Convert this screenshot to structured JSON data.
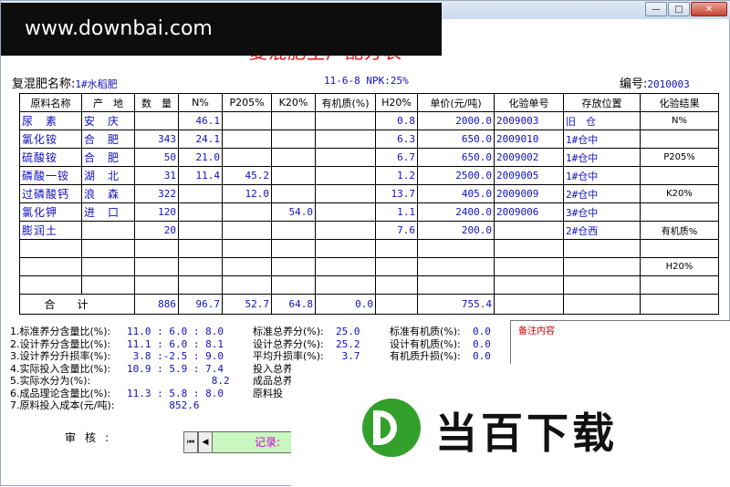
{
  "window": {
    "minimize_glyph": "—",
    "maximize_glyph": "□",
    "close_glyph": "✕"
  },
  "watermark": "www.downbai.com",
  "title": "复混肥生产配方表",
  "header": {
    "name_label": "复混肥名称:",
    "name_value": "1#水稻肥",
    "formula": "11-6-8 NPK:25%",
    "number_label": "编号:",
    "number_value": "2010003"
  },
  "table": {
    "columns": [
      "原料名称",
      "产　地",
      "数　量",
      "N%",
      "P205%",
      "K20%",
      "有机质(%)",
      "H20%",
      "单价(元/吨)",
      "化验单号",
      "存放位置",
      "化验结果"
    ],
    "rows": [
      {
        "name": "尿　素",
        "place": "安　庆",
        "qty": "",
        "n": "46.1",
        "p": "",
        "k": "",
        "org": "",
        "h2o": "0.8",
        "price": "2000.0",
        "test": "2009003",
        "loc": "旧　仓",
        "result": "N%"
      },
      {
        "name": "氯化铵",
        "place": "合　肥",
        "qty": "343",
        "n": "24.1",
        "p": "",
        "k": "",
        "org": "",
        "h2o": "6.3",
        "price": "650.0",
        "test": "2009010",
        "loc": "1#仓中",
        "result": ""
      },
      {
        "name": "硫酸铵",
        "place": "合　肥",
        "qty": "50",
        "n": "21.0",
        "p": "",
        "k": "",
        "org": "",
        "h2o": "6.7",
        "price": "650.0",
        "test": "2009002",
        "loc": "1#仓中",
        "result": "P205%"
      },
      {
        "name": "磷酸一铵",
        "place": "湖　北",
        "qty": "31",
        "n": "11.4",
        "p": "45.2",
        "k": "",
        "org": "",
        "h2o": "1.2",
        "price": "2500.0",
        "test": "2009005",
        "loc": "1#仓中",
        "result": ""
      },
      {
        "name": "过磷酸钙",
        "place": "浪　森",
        "qty": "322",
        "n": "",
        "p": "12.0",
        "k": "",
        "org": "",
        "h2o": "13.7",
        "price": "405.0",
        "test": "2009009",
        "loc": "2#仓中",
        "result": "K20%"
      },
      {
        "name": "氯化钾",
        "place": "进　口",
        "qty": "120",
        "n": "",
        "p": "",
        "k": "54.0",
        "org": "",
        "h2o": "1.1",
        "price": "2400.0",
        "test": "2009006",
        "loc": "3#仓中",
        "result": ""
      },
      {
        "name": "膨润土",
        "place": "",
        "qty": "20",
        "n": "",
        "p": "",
        "k": "",
        "org": "",
        "h2o": "7.6",
        "price": "200.0",
        "test": "",
        "loc": "2#仓西",
        "result": "有机质%"
      },
      {
        "name": "",
        "place": "",
        "qty": "",
        "n": "",
        "p": "",
        "k": "",
        "org": "",
        "h2o": "",
        "price": "",
        "test": "",
        "loc": "",
        "result": ""
      },
      {
        "name": "",
        "place": "",
        "qty": "",
        "n": "",
        "p": "",
        "k": "",
        "org": "",
        "h2o": "",
        "price": "",
        "test": "",
        "loc": "",
        "result": "H20%"
      },
      {
        "name": "",
        "place": "",
        "qty": "",
        "n": "",
        "p": "",
        "k": "",
        "org": "",
        "h2o": "",
        "price": "",
        "test": "",
        "loc": "",
        "result": ""
      }
    ],
    "total": {
      "label": "合计",
      "qty": "886",
      "n": "96.7",
      "p": "52.7",
      "k": "64.8",
      "org": "0.0",
      "price": "755.4"
    }
  },
  "stats_left": [
    {
      "label": "1.标准养分含量比(%):",
      "value": "11.0 : 6.0 : 8.0"
    },
    {
      "label": "2.设计养分含量比(%):",
      "value": "11.1 : 6.0 : 8.1"
    },
    {
      "label": "3.设计养分升损率(%):",
      "value": " 3.8 :-2.5 : 9.0"
    },
    {
      "label": "4.实际投入含量比(%):",
      "value": "10.9 : 5.9 : 7.4"
    },
    {
      "label": "5.实际水分为(%):",
      "value": "              8.2"
    },
    {
      "label": "6.成品理论含量比(%):",
      "value": "11.3 : 5.8 : 8.0"
    },
    {
      "label": "7.原料投入成本(元/吨):",
      "value": "       852.6"
    }
  ],
  "stats_mid": [
    {
      "label": "标准总养分(%):",
      "value": "  25.0"
    },
    {
      "label": "设计总养分(%):",
      "value": "  25.2"
    },
    {
      "label": "平均升损率(%):",
      "value": "   3.7"
    },
    {
      "label": "投入总养",
      "value": ""
    },
    {
      "label": "",
      "value": ""
    },
    {
      "label": "成品总养",
      "value": ""
    },
    {
      "label": "原料投",
      "value": ""
    }
  ],
  "stats_right": [
    {
      "label": "标准有机质(%):",
      "value": "  0.0"
    },
    {
      "label": "设计有机质(%):",
      "value": "  0.0"
    },
    {
      "label": "有机质升损(%):",
      "value": "  0.0"
    }
  ],
  "notes_label": "备注内容",
  "audit_label": "审核:",
  "nav": {
    "first": "⏮",
    "prev": "◀",
    "record_label": "记录:"
  },
  "logo_text": "当百下载"
}
